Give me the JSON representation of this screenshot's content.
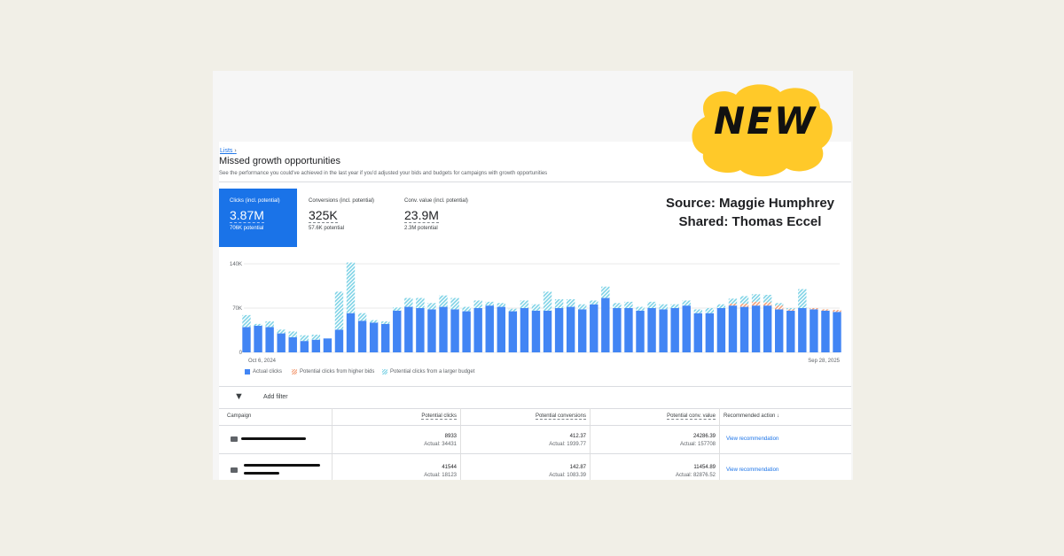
{
  "breadcrumb": {
    "label": "Lists",
    "separator": "›"
  },
  "page": {
    "title": "Missed growth opportunities",
    "subtitle": "See the performance you could've achieved in the last year if you'd adjusted your bids and budgets for campaigns with growth opportunities"
  },
  "metrics": [
    {
      "label": "Clicks (incl. potential)",
      "value": "3.87M",
      "sub": "706K potential",
      "active": true
    },
    {
      "label": "Conversions (incl. potential)",
      "value": "325K",
      "sub": "57.6K potential",
      "active": false
    },
    {
      "label": "Conv. value (incl. potential)",
      "value": "23.9M",
      "sub": "2.3M potential",
      "active": false
    }
  ],
  "overlay": {
    "source": "Source: Maggie Humphrey",
    "shared": "Shared: Thomas Eccel",
    "badge": "NEW"
  },
  "colors": {
    "actual": "#4285f4",
    "bids": "#f4a07a",
    "budget": "#7fd3e6",
    "accent": "#1a73e8"
  },
  "chart_data": {
    "type": "bar",
    "stacked": true,
    "x_start_label": "Oct 6, 2024",
    "x_end_label": "Sep 28, 2025",
    "y_ticks": [
      "140K",
      "70K",
      "0"
    ],
    "ylim": [
      0,
      140000
    ],
    "series": [
      {
        "name": "Actual clicks",
        "color": "#4285f4",
        "values": [
          40000,
          42000,
          40000,
          30000,
          24000,
          18000,
          20000,
          22000,
          36000,
          62000,
          50000,
          47000,
          45000,
          66000,
          72000,
          70000,
          68000,
          72000,
          68000,
          65000,
          70000,
          74000,
          72000,
          65000,
          70000,
          66000,
          66000,
          70000,
          72000,
          68000,
          76000,
          86000,
          70000,
          70000,
          66000,
          70000,
          68000,
          70000,
          74000,
          62000,
          62000,
          70000,
          74000,
          72000,
          74000,
          74000,
          68000,
          66000,
          70000,
          68000,
          66000,
          64000
        ]
      },
      {
        "name": "Potential clicks from higher bids",
        "color": "#f4a07a",
        "values": [
          0,
          0,
          0,
          0,
          0,
          0,
          0,
          0,
          0,
          0,
          0,
          0,
          0,
          0,
          0,
          0,
          0,
          0,
          0,
          0,
          0,
          0,
          0,
          0,
          0,
          0,
          0,
          0,
          0,
          0,
          0,
          0,
          0,
          0,
          0,
          0,
          0,
          0,
          0,
          0,
          0,
          0,
          3000,
          5000,
          6000,
          5000,
          6000,
          2000,
          0,
          2000,
          2000,
          3000
        ]
      },
      {
        "name": "Potential clicks from a larger budget",
        "color": "#7fd3e6",
        "values": [
          19000,
          3000,
          9000,
          6000,
          9000,
          9000,
          8000,
          0,
          60000,
          80000,
          12000,
          4000,
          4000,
          5000,
          14000,
          16000,
          10000,
          18000,
          18000,
          7000,
          12000,
          6000,
          6000,
          4000,
          12000,
          10000,
          30000,
          14000,
          12000,
          8000,
          6000,
          18000,
          8000,
          10000,
          6000,
          10000,
          8000,
          6000,
          8000,
          6000,
          8000,
          6000,
          8000,
          12000,
          12000,
          12000,
          4000,
          2000,
          30000,
          0,
          0,
          0
        ]
      }
    ]
  },
  "filter": {
    "label": "Add filter"
  },
  "table": {
    "headers": {
      "campaign": "Campaign",
      "clicks": "Potential clicks",
      "conversions": "Potential conversions",
      "value": "Potential conv. value",
      "action": "Recommended action",
      "sort": "↓"
    },
    "rows": [
      {
        "clicks": "8933",
        "clicks_actual": "Actual: 34431",
        "conv": "412.37",
        "conv_actual": "Actual: 1939.77",
        "value": "24286.39",
        "value_actual": "Actual: 157708",
        "action": "View recommendation"
      },
      {
        "clicks": "41544",
        "clicks_actual": "Actual: 18123",
        "conv": "142.87",
        "conv_actual": "Actual: 1083.39",
        "value": "11454.89",
        "value_actual": "Actual: 82876.52",
        "action": "View recommendation"
      }
    ]
  }
}
